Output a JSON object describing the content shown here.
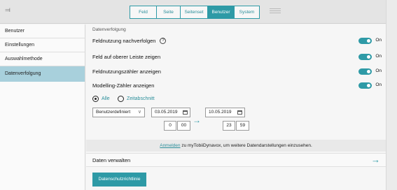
{
  "topbar": {
    "collapse_icon": "chevron-double-down-icon",
    "tabs": [
      {
        "label": "Feld",
        "active": false
      },
      {
        "label": "Seite",
        "active": false
      },
      {
        "label": "Seitenset",
        "active": false
      },
      {
        "label": "Benutzer",
        "active": true
      },
      {
        "label": "System",
        "active": false
      }
    ],
    "menu_icon": "hamburger-icon"
  },
  "sidebar": {
    "items": [
      {
        "label": "Benutzer",
        "active": false
      },
      {
        "label": "Einstellungen",
        "active": false
      },
      {
        "label": "Auswahlmethode",
        "active": false
      },
      {
        "label": "Datenverfolgung",
        "active": true
      }
    ]
  },
  "main": {
    "section_title": "Datenverfolgung",
    "toggles": [
      {
        "label": "Feldnutzung nachverfolgen",
        "state": "On",
        "help": "?"
      },
      {
        "label": "Feld auf oberer Leiste zeigen",
        "state": "On"
      },
      {
        "label": "Feldnutzungszähler anzeigen",
        "state": "On"
      },
      {
        "label": "Modelling-Zähler anzeigen",
        "state": "On"
      }
    ],
    "range": {
      "options": [
        "Alle",
        "Zeitabschnitt"
      ],
      "selected": "Alle",
      "preset": "Benutzerdefiniert",
      "start_date": "03.05.2019",
      "start_hour": "0",
      "start_minute": "00",
      "end_date": "10.05.2019",
      "end_hour": "23",
      "end_minute": "59"
    },
    "info": {
      "link": "Anmelden",
      "text": " zu myTobiiDynavox, um weitere Datendarstellungen einzusehen."
    },
    "manage_label": "Daten verwalten",
    "privacy_button": "Datenschutzrichtlinie"
  },
  "colors": {
    "accent": "#2e9aa6",
    "sidebar_active": "#a8d0dc"
  }
}
